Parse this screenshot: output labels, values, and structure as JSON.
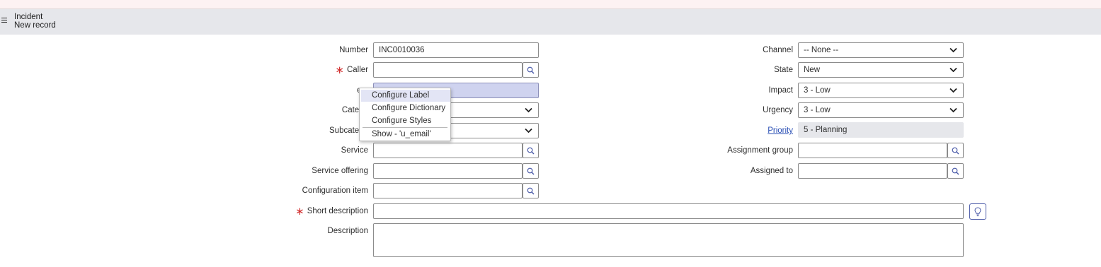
{
  "header": {
    "table": "Incident",
    "record": "New record"
  },
  "fields": {
    "number": {
      "label": "Number",
      "value": "INC0010036"
    },
    "caller": {
      "label": "Caller",
      "value": ""
    },
    "email": {
      "label": "email",
      "label_visible": "em",
      "value": ""
    },
    "category": {
      "label": "Category",
      "label_visible": "Catego",
      "value": ""
    },
    "subcategory": {
      "label": "Subcategory",
      "label_visible": "Subcatego",
      "value": ""
    },
    "service": {
      "label": "Service",
      "value": ""
    },
    "service_offering": {
      "label": "Service offering",
      "value": ""
    },
    "configuration_item": {
      "label": "Configuration item",
      "value": ""
    },
    "short_description": {
      "label": "Short description",
      "value": ""
    },
    "description": {
      "label": "Description",
      "value": ""
    },
    "channel": {
      "label": "Channel",
      "value": "-- None --"
    },
    "state": {
      "label": "State",
      "value": "New"
    },
    "impact": {
      "label": "Impact",
      "value": "3 - Low"
    },
    "urgency": {
      "label": "Urgency",
      "value": "3 - Low"
    },
    "priority": {
      "label": "Priority",
      "value": "5 - Planning"
    },
    "assignment_group": {
      "label": "Assignment group",
      "value": ""
    },
    "assigned_to": {
      "label": "Assigned to",
      "value": ""
    }
  },
  "context_menu": {
    "items": [
      "Configure Label",
      "Configure Dictionary",
      "Configure Styles",
      "Show - 'u_email'"
    ]
  },
  "colors": {
    "required_marker": "#d12d2d",
    "highlight_field": "#cfd3ef",
    "readonly_field": "#e6e7eb",
    "header_bg": "#e6e7eb",
    "link": "#2a4fb5"
  },
  "icons": {
    "menu": "hamburger-icon",
    "lookup": "magnifier-icon",
    "select": "chevron-down-icon",
    "suggestion": "lightbulb-icon"
  }
}
